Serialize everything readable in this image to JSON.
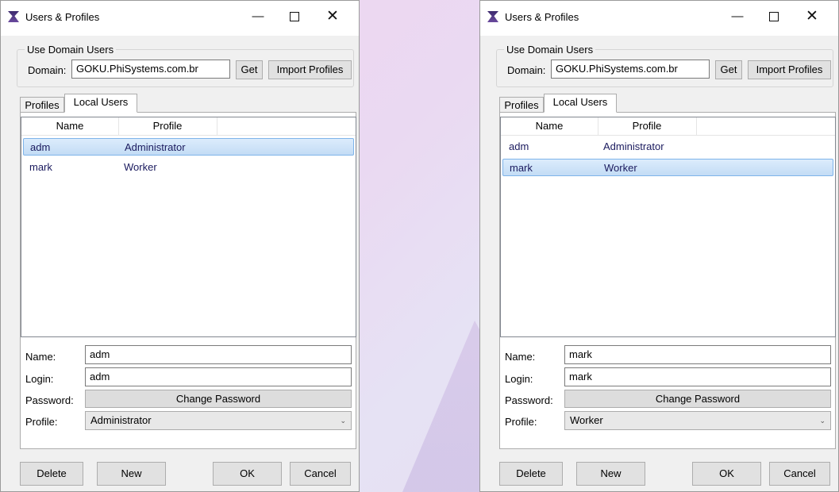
{
  "windows": [
    {
      "title": "Users & Profiles",
      "group_title": "Use Domain Users",
      "domain_label": "Domain:",
      "domain_value": "GOKU.PhiSystems.com.br",
      "get_label": "Get",
      "import_label": "Import Profiles",
      "tabs": [
        "Profiles",
        "Local Users"
      ],
      "active_tab": "Local Users",
      "columns": [
        "Name",
        "Profile"
      ],
      "rows": [
        {
          "name": "adm",
          "profile": "Administrator",
          "selected": true
        },
        {
          "name": "mark",
          "profile": "Worker",
          "selected": false
        }
      ],
      "name_label": "Name:",
      "name_value": "adm",
      "login_label": "Login:",
      "login_value": "adm",
      "password_label": "Password:",
      "change_password_label": "Change Password",
      "profile_label": "Profile:",
      "profile_value": "Administrator",
      "delete_label": "Delete",
      "new_label": "New",
      "ok_label": "OK",
      "cancel_label": "Cancel"
    },
    {
      "title": "Users & Profiles",
      "group_title": "Use Domain Users",
      "domain_label": "Domain:",
      "domain_value": "GOKU.PhiSystems.com.br",
      "get_label": "Get",
      "import_label": "Import Profiles",
      "tabs": [
        "Profiles",
        "Local Users"
      ],
      "active_tab": "Local Users",
      "columns": [
        "Name",
        "Profile"
      ],
      "rows": [
        {
          "name": "adm",
          "profile": "Administrator",
          "selected": false
        },
        {
          "name": "mark",
          "profile": "Worker",
          "selected": true
        }
      ],
      "name_label": "Name:",
      "name_value": "mark",
      "login_label": "Login:",
      "login_value": "mark",
      "password_label": "Password:",
      "change_password_label": "Change Password",
      "profile_label": "Profile:",
      "profile_value": "Worker",
      "delete_label": "Delete",
      "new_label": "New",
      "ok_label": "OK",
      "cancel_label": "Cancel"
    }
  ],
  "caption_buttons": {
    "minimize": "—",
    "close": "✕"
  }
}
